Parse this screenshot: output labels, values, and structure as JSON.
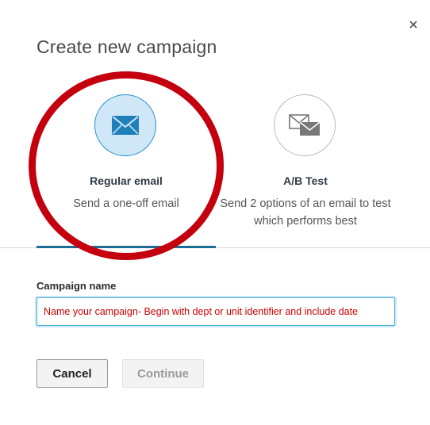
{
  "dialog": {
    "title": "Create new campaign",
    "close_label": "×"
  },
  "options": [
    {
      "label": "Regular email",
      "description": "Send a one-off email",
      "icon": "envelope-icon",
      "selected": true
    },
    {
      "label": "A/B Test",
      "description": "Send 2 options of an email to test which performs best",
      "icon": "ab-envelopes-icon",
      "selected": false
    }
  ],
  "form": {
    "campaign_name_label": "Campaign name",
    "campaign_name_placeholder": "Name your campaign- Begin with dept or unit identifier and include date",
    "campaign_name_value": ""
  },
  "actions": {
    "cancel_label": "Cancel",
    "continue_label": "Continue"
  },
  "colors": {
    "selected_accent": "#1d6c94",
    "selected_icon_bg": "#cfe7f6",
    "annotation_ring": "#c4000f",
    "placeholder_text": "#cc0000"
  }
}
